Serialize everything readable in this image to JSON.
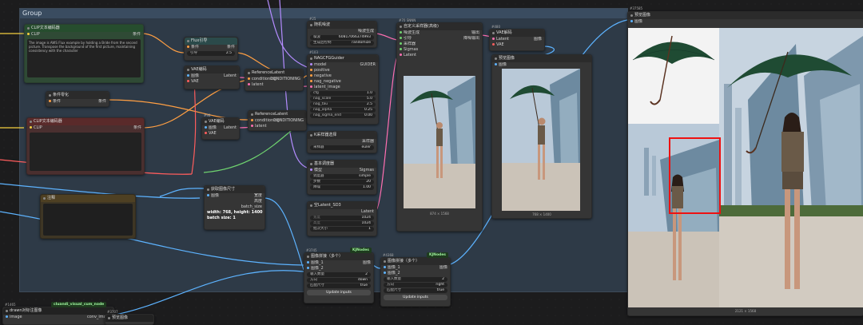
{
  "group": {
    "title": "Group"
  },
  "nodes": {
    "clip_pos": {
      "title": "CLIP文本编码器",
      "in_clip": "CLIP",
      "out": "条件",
      "text": "The image is AWS Flux example by holding a Bride from the second picture. Transpose the background of the first picture, maintaining consistency with the character"
    },
    "flux_guide": {
      "title": "Flux引导",
      "in": "条件",
      "out": "条件",
      "w_label": "引导",
      "w_val": "2.5"
    },
    "vae_enc1": {
      "title": "VAE编码",
      "in1": "图像",
      "in2": "VAE",
      "out": "Latent"
    },
    "cond_zero": {
      "title": "条件零化",
      "in": "条件",
      "out": "条件"
    },
    "clip_neg": {
      "title": "CLIP文本编码器",
      "in_clip": "CLIP",
      "out": "条件"
    },
    "vae_enc2": {
      "id": "#98",
      "title": "VAE编码",
      "in1": "图像",
      "in2": "VAE",
      "out": "Latent"
    },
    "note": {
      "title": "注释"
    },
    "ref_latent1": {
      "title": "ReferenceLatent",
      "in1": "conditioning",
      "in2": "latent",
      "out": "CONDITIONING"
    },
    "ref_latent2": {
      "title": "ReferenceLatent",
      "in1": "conditioning",
      "in2": "latent",
      "out": "CONDITIONING"
    },
    "noise": {
      "id": "#25",
      "title": "随机噪波",
      "out": "噪波生成",
      "w1_label": "噪波",
      "w1_val": "60817066374993",
      "w2_label": "生成后控制",
      "w2_val": "randomize"
    },
    "guider": {
      "id": "#103",
      "title": "NAGCFGGuider",
      "in1": "model",
      "in2": "positive",
      "in3": "negative",
      "in4": "nag_negative",
      "in5": "latent_image",
      "out": "GUIDER",
      "w": [
        {
          "l": "cfg",
          "v": "1.0"
        },
        {
          "l": "nag_scale",
          "v": "5.0"
        },
        {
          "l": "nag_tau",
          "v": "2.5"
        },
        {
          "l": "nag_alpha",
          "v": "0.25"
        },
        {
          "l": "nag_sigma_end",
          "v": "0.00"
        }
      ]
    },
    "sampler_select": {
      "title": "K采样器选择",
      "out": "采样器",
      "w_label": "采样器",
      "w_val": "euler"
    },
    "scheduler": {
      "title": "基本调度器",
      "in": "模型",
      "out": "Sigmas",
      "w": [
        {
          "l": "调度器",
          "v": "simple"
        },
        {
          "l": "步数",
          "v": "20"
        },
        {
          "l": "降噪",
          "v": "1.00"
        }
      ]
    },
    "empty_latent": {
      "title": "空Latent_SD3",
      "out": "Latent",
      "w": [
        {
          "l": "宽度",
          "v": "1024"
        },
        {
          "l": "高度",
          "v": "1024"
        },
        {
          "l": "批次大小",
          "v": "1"
        }
      ]
    },
    "adv_sampler": {
      "id": "#70 SNNN",
      "title": "自定义采样器(高级)",
      "in": [
        "噪波生成",
        "引导",
        "采样器",
        "Sigmas",
        "Latent"
      ],
      "out1": "输出",
      "out2": "降噪输出",
      "caption": "874 × 1568"
    },
    "vae_dec": {
      "id": "#480",
      "title": "VAE解码",
      "in1": "Latent",
      "in2": "VAE",
      "out": "图像"
    },
    "preview1": {
      "title": "预览图像",
      "in": "图像",
      "caption": "768 × 1400"
    },
    "get_size": {
      "title": "获取图像尺寸",
      "in": "图像",
      "out1": "宽度",
      "out2": "高度",
      "out3": "batch_size",
      "info1": "width: 768, height: 1400",
      "info2": "batch size: 1"
    },
    "stitch1": {
      "id": "#3745",
      "badge": "KJNodes",
      "title": "图像拼接（多个）",
      "in1": "图像_1",
      "in2": "图像_2",
      "out": "图像",
      "w": [
        {
          "l": "输入数量",
          "v": "2"
        },
        {
          "l": "方向",
          "v": "down"
        },
        {
          "l": "匹配尺寸",
          "v": "true"
        }
      ],
      "btn": "Update inputs"
    },
    "stitch2": {
      "id": "#4368",
      "badge": "KJNodes",
      "title": "图像拼接（多个）",
      "in1": "图像_1",
      "in2": "图像_2",
      "out": "图像",
      "w": [
        {
          "l": "输入数量",
          "v": "2"
        },
        {
          "l": "方向",
          "v": "right"
        },
        {
          "l": "匹配尺寸",
          "v": "true"
        }
      ],
      "btn": "Update inputs"
    },
    "preview2": {
      "id": "#37585",
      "title": "预览图像",
      "in": "图像",
      "caption": "2121 × 1568"
    },
    "bottom_left": {
      "id": "#1465",
      "title": "drawn对标注图像",
      "in": "image",
      "out": "conv_image",
      "badge": "cluandi_visual_cum_node"
    },
    "bottom_mid": {
      "id": "#3707",
      "title": "预览图像"
    }
  },
  "colors": {
    "clip_wire": "#f4d03f",
    "cond_wire": "#ff9f43",
    "latent_wire": "#ff6fb1",
    "image_wire": "#5db3ff",
    "model_wire": "#b48cff",
    "vae_wire": "#ff5d5d",
    "red_box": "#ee1111"
  }
}
